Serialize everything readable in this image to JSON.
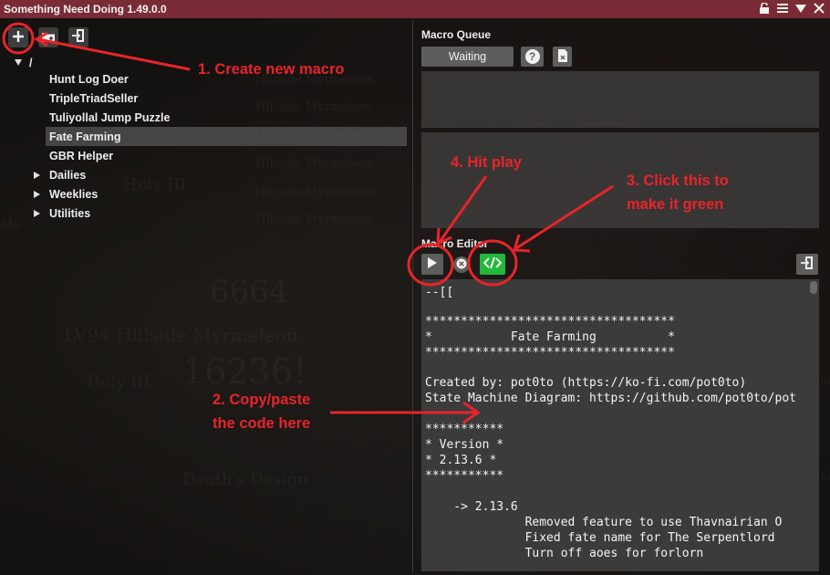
{
  "window": {
    "title": "Something Need Doing 1.49.0.0"
  },
  "titlebar_icons": [
    "lock-icon",
    "menu-lines-icon",
    "collapse-triangle-icon",
    "close-x-icon"
  ],
  "toolbar": {
    "icons": [
      "plus-icon",
      "folder-add-icon",
      "import-icon"
    ]
  },
  "tree": {
    "root": "/",
    "items": [
      {
        "label": "Hunt Log Doer"
      },
      {
        "label": "TripleTriadSeller"
      },
      {
        "label": "Tuliyollal Jump Puzzle"
      },
      {
        "label": "Fate Farming",
        "selected": true
      },
      {
        "label": "GBR Helper"
      }
    ],
    "folders": [
      {
        "label": "Dailies"
      },
      {
        "label": "Weeklies"
      },
      {
        "label": "Utilities"
      }
    ]
  },
  "queue": {
    "label": "Macro Queue",
    "status_button": "Waiting",
    "help_glyph": "?"
  },
  "editor": {
    "label": "Macro Editor",
    "lines": [
      "--[[",
      "",
      "***********************************",
      "*           Fate Farming          *",
      "***********************************",
      "",
      "Created by: pot0to (https://ko-fi.com/pot0to)",
      "State Machine Diagram: https://github.com/pot0to/pot",
      "",
      "***********",
      "* Version *",
      "* 2.13.6 *",
      "***********",
      "",
      "    -> 2.13.6",
      "              Removed feature to use Thavnairian O",
      "              Fixed fate name for The Serpentlord",
      "              Turn off aoes for forlorn"
    ]
  },
  "annotations": {
    "step1": "1. Create new macro",
    "step2_line1": "2. Copy/paste",
    "step2_line2": "the code here",
    "step3_line1": "3. Click this to",
    "step3_line2": "make it green",
    "step4": "4. Hit play"
  },
  "colors": {
    "annotation_red": "#e8242a",
    "titlebar": "#7a2b35",
    "toggle_green": "#22b83a"
  }
}
